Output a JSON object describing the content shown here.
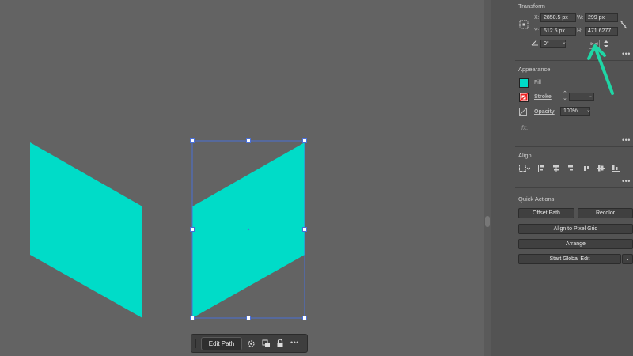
{
  "transform": {
    "title": "Transform",
    "x_label": "X:",
    "x_value": "2850.5 px",
    "w_label": "W:",
    "w_value": "299 px",
    "y_label": "Y:",
    "y_value": "512.5 px",
    "h_label": "H:",
    "h_value": "471.6277",
    "angle_value": "0°"
  },
  "appearance": {
    "title": "Appearance",
    "fill_label": "Fill",
    "stroke_label": "Stroke",
    "opacity_label": "Opacity",
    "opacity_value": "100%",
    "fx_label": "fx.",
    "fill_color": "#00dcc8"
  },
  "align": {
    "title": "Align"
  },
  "quick_actions": {
    "title": "Quick Actions",
    "offset_path": "Offset Path",
    "recolor": "Recolor",
    "align_pixel": "Align to Pixel Grid",
    "arrange": "Arrange",
    "global_edit": "Start Global Edit"
  },
  "context_bar": {
    "edit_path": "Edit Path"
  },
  "colors": {
    "shape": "#00dcc8",
    "arrow": "#1fd6a5",
    "selection": "#4a6fd6",
    "canvas": "#636363",
    "panel": "#535353"
  }
}
